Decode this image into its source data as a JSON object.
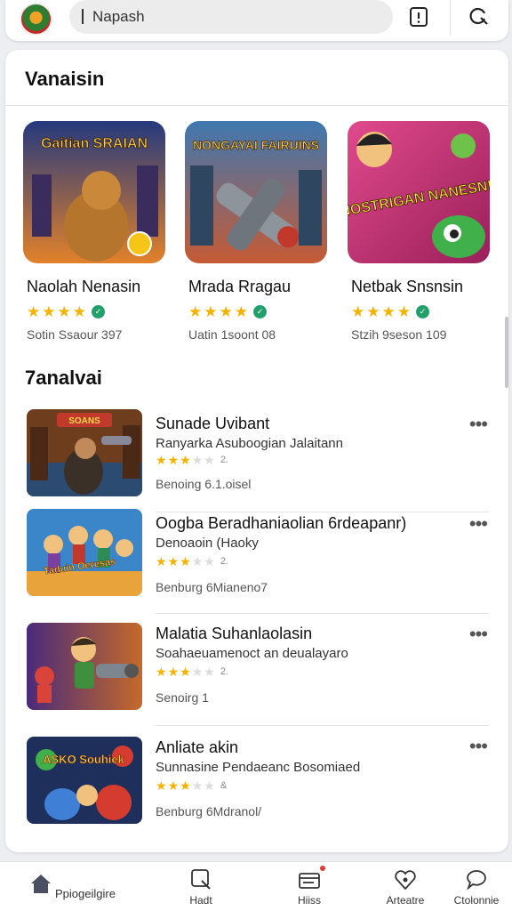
{
  "search": {
    "value": "Napash"
  },
  "featured": {
    "title": "Vanaisin",
    "items": [
      {
        "name": "Naolah Nenasin",
        "art_text": "Gaitian SRAIAN",
        "stars": 4,
        "meta": "Sotin Ssaour 397",
        "colors": [
          "#2a3f8f",
          "#e57c23"
        ]
      },
      {
        "name": "Mrada Rragau",
        "art_text": "NONGAYAI FAIRUINS",
        "stars": 4,
        "meta": "Uatin 1soont 08",
        "colors": [
          "#3b6f9e",
          "#c9573a"
        ]
      },
      {
        "name": "Netbak Snsnsin",
        "art_text": "NOSTRIGAN NANESN!",
        "stars": 4,
        "meta": "Stzih 9seson 109",
        "colors": [
          "#b31e6a",
          "#3a8f2d"
        ]
      }
    ]
  },
  "list": {
    "title": "7analvai",
    "items": [
      {
        "title": "Sunade Uvibant",
        "sub": "Ranyarka Asuboogian Jalaitann",
        "stars": 3,
        "rcount": "2.",
        "meta": "Benoing 6.1.oisel",
        "art_text": "SOANS",
        "colors": [
          "#6b3b1f",
          "#2b4e73"
        ]
      },
      {
        "title": "Oogba Beradhaniaolian 6rdeapanr)",
        "sub": "Denoaoin (Haoky",
        "stars": 3,
        "rcount": "2.",
        "meta": "Benburg 6Mianeno7",
        "art_text": "Taduin Oeresas",
        "colors": [
          "#2f7bbf",
          "#f0a324"
        ]
      },
      {
        "title": "Malatia Suhanlaolasin",
        "sub": "Soahaeuamenoct an deualayaro",
        "stars": 3,
        "rcount": "2.",
        "meta": "Senoirg 1",
        "art_text": "",
        "colors": [
          "#4a2a7a",
          "#c46a2a"
        ]
      },
      {
        "title": "Anliate akin",
        "sub": "Sunnasine Pendaeanc Bosomiaed",
        "stars": 3,
        "rcount": "&",
        "meta": "Benburg 6Mdranol/",
        "art_text": "ASKO Souhiek",
        "colors": [
          "#1f7a3b",
          "#d63b2f"
        ]
      }
    ]
  },
  "nav": [
    {
      "label": "Ppiogeilgire"
    },
    {
      "label": "Hadt"
    },
    {
      "label": "Hiiss"
    },
    {
      "label": "Arteatre"
    },
    {
      "label": "Ctolonnie"
    }
  ]
}
